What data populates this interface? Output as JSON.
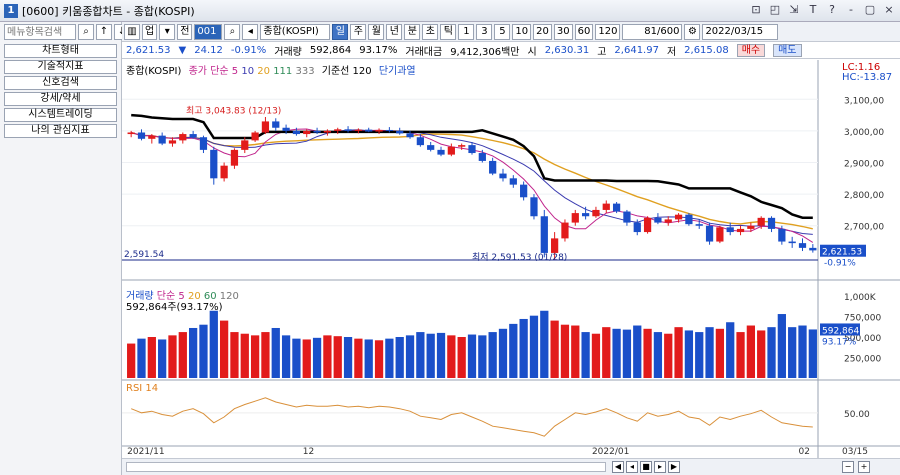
{
  "window": {
    "title": "[0600] 키움종합차트 - 종합(KOSPI)",
    "app_icon": "1",
    "controls": [
      "⊡",
      "◰",
      "⇲",
      "T",
      "?",
      "-",
      "▢",
      "×"
    ]
  },
  "toolbar": {
    "type_select": "업",
    "type2": "전",
    "code": "001",
    "name": "종합(KOSPI)",
    "periods": [
      "일",
      "주",
      "월",
      "년",
      "분",
      "초",
      "틱"
    ],
    "active_period": "일",
    "intervals": [
      "1",
      "3",
      "5",
      "10",
      "20",
      "30",
      "60",
      "120"
    ],
    "count": "81/600",
    "date": "2022/03/15"
  },
  "sidebar": {
    "search_placeholder": "메뉴항목검색",
    "items": [
      "차트형태",
      "기술적지표",
      "신호검색",
      "강세/약세",
      "시스템트레이딩",
      "나의 관심지표"
    ]
  },
  "quote": {
    "price": "2,621.53",
    "change_arrow": "▼",
    "change": "24.12",
    "change_pct": "-0.91%",
    "volume_label": "거래량",
    "volume": "592,864",
    "vol_pct": "93.17%",
    "amount_label": "거래대금",
    "amount": "9,412,306백만",
    "open_label": "시",
    "open": "2,630.31",
    "high_label": "고",
    "high": "2,641.97",
    "low_label": "저",
    "low": "2,615.08",
    "buy": "매수",
    "sell": "매도"
  },
  "price_legend": {
    "name": "종합(KOSPI)",
    "ma_label": "종가 단순",
    "ma": [
      "5",
      "10",
      "20",
      "111",
      "333"
    ],
    "base_label": "기준선 120",
    "short_label": "단기과열"
  },
  "price_panel": {
    "lc": "LC:1.16",
    "hc": "HC:-13.87",
    "y_ticks": [
      "3,100,00",
      "3,000,00",
      "2,900,00",
      "2,800,00",
      "2,700,00"
    ],
    "current": "2,621.53",
    "current_pct": "-0.91%",
    "hi_label": "최고 3,043.83 (12/13)",
    "lo_label": "최저 2,591.53 (01/28)",
    "lo_line_label": "2,591.54"
  },
  "volume_legend": {
    "name": "거래량",
    "ma_label": "단순",
    "ma": [
      "5",
      "20",
      "60",
      "120"
    ],
    "last": "592,864주(93.17%)"
  },
  "volume_panel": {
    "y_ticks": [
      "1,000K",
      "750,000",
      "500,000",
      "250,000"
    ],
    "current": "592,864",
    "current_pct": "93.17%"
  },
  "rsi": {
    "label": "RSI 14",
    "tick": "50.00"
  },
  "x_axis": {
    "labels": [
      "2021/11",
      "12",
      "2022/01",
      "02",
      "03"
    ],
    "right": "03/15"
  },
  "chart_data": {
    "type": "candlestick",
    "candles": [
      [
        2990,
        3000,
        2980,
        2995
      ],
      [
        2995,
        3005,
        2970,
        2975
      ],
      [
        2975,
        2990,
        2960,
        2985
      ],
      [
        2985,
        2995,
        2955,
        2960
      ],
      [
        2960,
        2980,
        2950,
        2970
      ],
      [
        2970,
        2995,
        2960,
        2990
      ],
      [
        2990,
        3000,
        2975,
        2980
      ],
      [
        2980,
        2985,
        2930,
        2940
      ],
      [
        2940,
        2950,
        2830,
        2850
      ],
      [
        2850,
        2900,
        2840,
        2890
      ],
      [
        2890,
        2945,
        2880,
        2940
      ],
      [
        2940,
        2980,
        2930,
        2970
      ],
      [
        2970,
        3000,
        2965,
        2995
      ],
      [
        2995,
        3044,
        2990,
        3030
      ],
      [
        3030,
        3040,
        3000,
        3010
      ],
      [
        3010,
        3020,
        2990,
        3000
      ],
      [
        3000,
        3010,
        2985,
        2990
      ],
      [
        2990,
        3005,
        2980,
        3000
      ],
      [
        3000,
        3010,
        2990,
        2995
      ],
      [
        2995,
        3005,
        2985,
        3000
      ],
      [
        3000,
        3010,
        2990,
        3005
      ],
      [
        3005,
        3015,
        2995,
        3000
      ],
      [
        3000,
        3008,
        2992,
        3004
      ],
      [
        3004,
        3010,
        2996,
        2998
      ],
      [
        2998,
        3008,
        2990,
        3003
      ],
      [
        3003,
        3012,
        2995,
        3000
      ],
      [
        3000,
        3010,
        2988,
        2992
      ],
      [
        2992,
        3000,
        2975,
        2980
      ],
      [
        2980,
        2990,
        2950,
        2955
      ],
      [
        2955,
        2965,
        2935,
        2940
      ],
      [
        2940,
        2950,
        2920,
        2925
      ],
      [
        2925,
        2960,
        2920,
        2950
      ],
      [
        2950,
        2960,
        2940,
        2955
      ],
      [
        2955,
        2965,
        2925,
        2930
      ],
      [
        2930,
        2940,
        2900,
        2905
      ],
      [
        2905,
        2915,
        2860,
        2865
      ],
      [
        2865,
        2880,
        2840,
        2850
      ],
      [
        2850,
        2860,
        2820,
        2830
      ],
      [
        2830,
        2840,
        2780,
        2790
      ],
      [
        2790,
        2800,
        2720,
        2730
      ],
      [
        2730,
        2750,
        2600,
        2614
      ],
      [
        2614,
        2680,
        2591,
        2660
      ],
      [
        2660,
        2720,
        2650,
        2710
      ],
      [
        2710,
        2750,
        2700,
        2740
      ],
      [
        2740,
        2760,
        2720,
        2730
      ],
      [
        2730,
        2760,
        2725,
        2750
      ],
      [
        2750,
        2780,
        2740,
        2770
      ],
      [
        2770,
        2775,
        2740,
        2745
      ],
      [
        2745,
        2750,
        2700,
        2710
      ],
      [
        2710,
        2720,
        2670,
        2680
      ],
      [
        2680,
        2730,
        2675,
        2725
      ],
      [
        2725,
        2740,
        2705,
        2710
      ],
      [
        2710,
        2730,
        2700,
        2720
      ],
      [
        2720,
        2740,
        2710,
        2735
      ],
      [
        2735,
        2740,
        2700,
        2705
      ],
      [
        2705,
        2720,
        2690,
        2700
      ],
      [
        2700,
        2710,
        2640,
        2650
      ],
      [
        2650,
        2700,
        2645,
        2695
      ],
      [
        2695,
        2710,
        2670,
        2680
      ],
      [
        2680,
        2700,
        2670,
        2690
      ],
      [
        2690,
        2710,
        2680,
        2700
      ],
      [
        2700,
        2730,
        2690,
        2725
      ],
      [
        2725,
        2730,
        2680,
        2690
      ],
      [
        2690,
        2700,
        2640,
        2650
      ],
      [
        2650,
        2665,
        2630,
        2645
      ],
      [
        2645,
        2660,
        2620,
        2630
      ],
      [
        2630,
        2642,
        2615,
        2622
      ]
    ],
    "volume": [
      420,
      480,
      500,
      470,
      520,
      560,
      610,
      650,
      820,
      700,
      560,
      540,
      520,
      560,
      610,
      520,
      480,
      470,
      490,
      520,
      510,
      500,
      480,
      470,
      460,
      480,
      500,
      520,
      560,
      540,
      550,
      520,
      500,
      530,
      520,
      560,
      600,
      660,
      720,
      760,
      820,
      700,
      650,
      640,
      560,
      540,
      620,
      600,
      590,
      640,
      600,
      560,
      540,
      620,
      580,
      560,
      620,
      600,
      680,
      560,
      640,
      580,
      620,
      780,
      620,
      640,
      592
    ],
    "rsi": [
      55,
      50,
      52,
      48,
      46,
      52,
      55,
      49,
      38,
      45,
      55,
      60,
      64,
      68,
      63,
      60,
      57,
      59,
      58,
      58,
      59,
      57,
      58,
      56,
      58,
      57,
      55,
      52,
      46,
      44,
      42,
      48,
      50,
      45,
      40,
      34,
      32,
      30,
      28,
      26,
      22,
      34,
      42,
      50,
      48,
      51,
      55,
      50,
      44,
      40,
      50,
      46,
      48,
      52,
      45,
      43,
      35,
      45,
      42,
      46,
      49,
      53,
      45,
      38,
      36,
      34,
      33
    ]
  }
}
